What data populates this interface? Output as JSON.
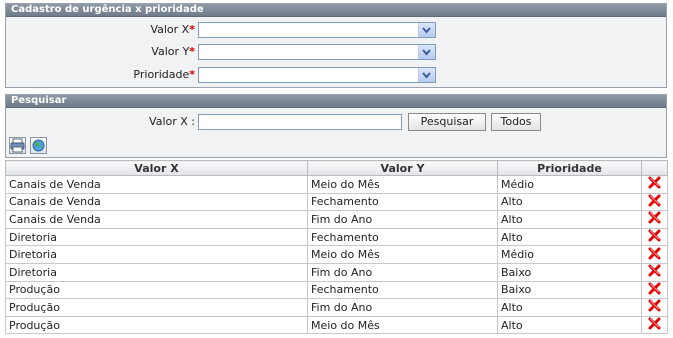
{
  "register_panel": {
    "title": "Cadastro de urgência x prioridade",
    "fields": [
      {
        "label": "Valor X",
        "required_mark": "*",
        "value": ""
      },
      {
        "label": "Valor Y",
        "required_mark": "*",
        "value": ""
      },
      {
        "label": "Prioridade",
        "required_mark": "*",
        "value": ""
      }
    ]
  },
  "search_panel": {
    "title": "Pesquisar",
    "label": "Valor X :",
    "value": "",
    "search_button": "Pesquisar",
    "all_button": "Todos"
  },
  "toolbar": {
    "icons": [
      "print-icon",
      "globe-icon"
    ]
  },
  "grid": {
    "columns": [
      "Valor X",
      "Valor Y",
      "Prioridade",
      ""
    ],
    "rows": [
      {
        "x": "Canais de Venda",
        "y": "Meio do Mês",
        "p": "Médio"
      },
      {
        "x": "Canais de Venda",
        "y": "Fechamento",
        "p": "Alto"
      },
      {
        "x": "Canais de Venda",
        "y": "Fim do Ano",
        "p": "Alto"
      },
      {
        "x": "Diretoria",
        "y": "Fechamento",
        "p": "Alto"
      },
      {
        "x": "Diretoria",
        "y": "Meio do Mês",
        "p": "Médio"
      },
      {
        "x": "Diretoria",
        "y": "Fim do Ano",
        "p": "Baixo"
      },
      {
        "x": "Produção",
        "y": "Fechamento",
        "p": "Baixo"
      },
      {
        "x": "Produção",
        "y": "Fim do Ano",
        "p": "Alto"
      },
      {
        "x": "Produção",
        "y": "Meio do Mês",
        "p": "Alto"
      }
    ],
    "row_action_icon": "delete-icon"
  },
  "colors": {
    "panel_header": "#7f8b97",
    "required": "#d40000",
    "delete": "#e00000"
  }
}
